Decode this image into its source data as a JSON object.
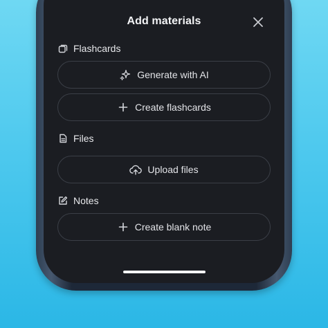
{
  "header": {
    "title": "Add materials"
  },
  "sections": {
    "flashcards": {
      "label": "Flashcards",
      "icon": "cards-icon",
      "actions": {
        "generate": {
          "label": "Generate with AI",
          "icon": "sparkle-icon"
        },
        "create": {
          "label": "Create flashcards",
          "icon": "plus-icon"
        }
      }
    },
    "files": {
      "label": "Files",
      "icon": "document-icon",
      "actions": {
        "upload": {
          "label": "Upload files",
          "icon": "upload-cloud-icon"
        }
      }
    },
    "notes": {
      "label": "Notes",
      "icon": "edit-note-icon",
      "actions": {
        "create": {
          "label": "Create blank note",
          "icon": "plus-icon"
        }
      }
    }
  },
  "colors": {
    "background_top": "#6fd8f3",
    "background_bottom": "#2bb7e6",
    "sheet": "#1b1d22",
    "pill_border": "#3b3f47",
    "text": "#e3e4e8"
  }
}
